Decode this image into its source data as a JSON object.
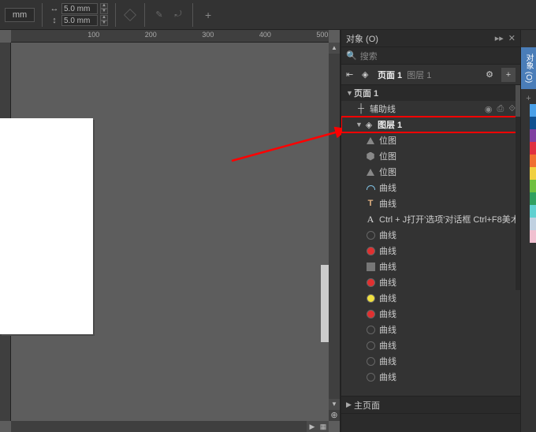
{
  "topbar": {
    "unit": "mm",
    "width": "5.0 mm",
    "height": "5.0 mm"
  },
  "ruler_ticks": [
    "100",
    "200",
    "300",
    "400",
    "500"
  ],
  "panel": {
    "title": "对象 (O)",
    "search_placeholder": "搜索",
    "crumb_page": "页面 1",
    "crumb_layer": "图层 1"
  },
  "tree": {
    "page_header": "页面 1",
    "guides": "辅助线",
    "layer": "图层 1",
    "master": "主页面",
    "items": [
      {
        "icon": "tri",
        "label": "位图"
      },
      {
        "icon": "hex",
        "label": "位图"
      },
      {
        "icon": "tri",
        "label": "位图"
      },
      {
        "icon": "arc",
        "label": "曲线"
      },
      {
        "icon": "tshape",
        "label": "曲线"
      },
      {
        "icon": "ashape",
        "label": "Ctrl + J打开'选项'对话框 Ctrl+F8美术"
      },
      {
        "icon": "circle",
        "color": "transparent",
        "label": "曲线"
      },
      {
        "icon": "circle",
        "color": "#e03030",
        "label": "曲线"
      },
      {
        "icon": "sq",
        "label": "曲线"
      },
      {
        "icon": "circle",
        "color": "#e03030",
        "label": "曲线"
      },
      {
        "icon": "circle",
        "color": "#f0e040",
        "label": "曲线"
      },
      {
        "icon": "circle",
        "color": "#e03030",
        "label": "曲线"
      },
      {
        "icon": "circle",
        "color": "transparent",
        "label": "曲线"
      },
      {
        "icon": "circle",
        "color": "transparent",
        "label": "曲线"
      },
      {
        "icon": "circle",
        "color": "transparent",
        "label": "曲线"
      },
      {
        "icon": "circle",
        "color": "transparent",
        "label": "曲线"
      }
    ]
  },
  "tab_label": "对象 (O)",
  "palette": [
    "#4aa0e8",
    "#105090",
    "#8040a0",
    "#e03040",
    "#f07030",
    "#f0d040",
    "#70c040",
    "#30a060",
    "#60d0d0",
    "#c0d0e0",
    "#f0c0d0"
  ]
}
